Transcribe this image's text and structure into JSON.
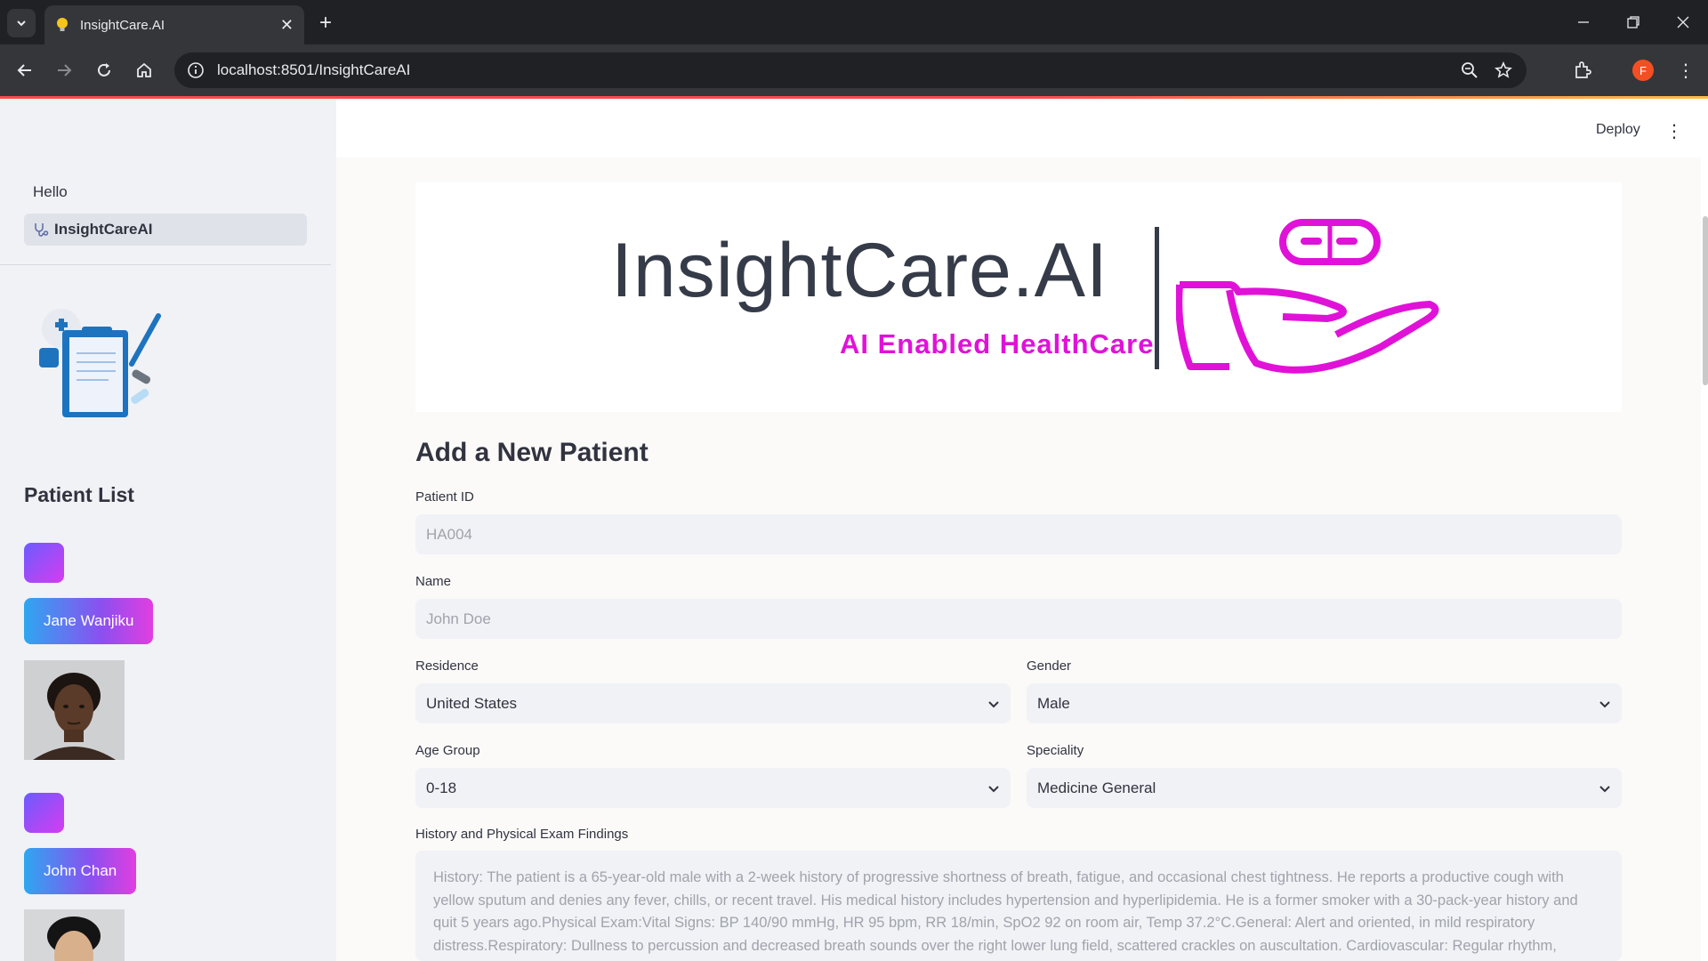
{
  "browser": {
    "tab_title": "InsightCare.AI",
    "url": "localhost:8501/InsightCareAI",
    "profile_initial": "F"
  },
  "app": {
    "deploy_label": "Deploy"
  },
  "sidebar": {
    "nav_items": [
      {
        "label": "Hello",
        "active": false
      },
      {
        "label": "InsightCareAI",
        "active": true
      }
    ],
    "patient_list_title": "Patient List",
    "patients": [
      {
        "name": "Jane Wanjiku"
      },
      {
        "name": "John Chan"
      }
    ]
  },
  "banner": {
    "brand": "InsightCare.AI",
    "tagline": "AI Enabled HealthCare"
  },
  "form": {
    "title": "Add a New Patient",
    "patient_id": {
      "label": "Patient ID",
      "placeholder": "HA004"
    },
    "name": {
      "label": "Name",
      "placeholder": "John Doe"
    },
    "residence": {
      "label": "Residence",
      "value": "United States"
    },
    "gender": {
      "label": "Gender",
      "value": "Male"
    },
    "age_group": {
      "label": "Age Group",
      "value": "0-18"
    },
    "speciality": {
      "label": "Speciality",
      "value": "Medicine General"
    },
    "history": {
      "label": "History and Physical Exam Findings",
      "placeholder": "History: The patient is a 65-year-old male with a 2-week history of progressive shortness of breath, fatigue, and occasional chest tightness. He reports a productive cough with yellow sputum and denies any fever, chills, or recent travel. His medical history includes hypertension and hyperlipidemia. He is a former smoker with a 30-pack-year history and quit 5 years ago.Physical Exam:Vital Signs: BP 140/90 mmHg, HR 95 bpm, RR 18/min, SpO2 92 on room air, Temp 37.2°C.General: Alert and oriented, in mild respiratory distress.Respiratory: Dullness to percussion and decreased breath sounds over the right lower lung field, scattered crackles on auscultation. Cardiovascular: Regular rhythm,"
    }
  }
}
